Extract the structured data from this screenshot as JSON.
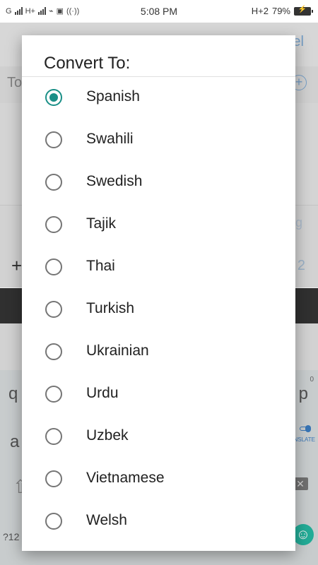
{
  "status_bar": {
    "carrier": "G",
    "network": "H+",
    "time": "5:08 PM",
    "network_right": "H+2",
    "battery": "79%"
  },
  "background": {
    "cancel_label": "el",
    "to_label": "To",
    "plus_label": "+",
    "count_label": "2",
    "g_label": "g"
  },
  "keyboard": {
    "q": "q",
    "p": "p",
    "zero": "0",
    "a": "a",
    "translate": "ANSLATE",
    "sym": "?12"
  },
  "dialog": {
    "title": "Convert To:",
    "selected": "Spanish",
    "accent_color": "#1a8f87",
    "options": [
      {
        "label": "Spanish",
        "checked": true
      },
      {
        "label": "Swahili",
        "checked": false
      },
      {
        "label": "Swedish",
        "checked": false
      },
      {
        "label": "Tajik",
        "checked": false
      },
      {
        "label": "Thai",
        "checked": false
      },
      {
        "label": "Turkish",
        "checked": false
      },
      {
        "label": "Ukrainian",
        "checked": false
      },
      {
        "label": "Urdu",
        "checked": false
      },
      {
        "label": "Uzbek",
        "checked": false
      },
      {
        "label": "Vietnamese",
        "checked": false
      },
      {
        "label": "Welsh",
        "checked": false
      }
    ]
  }
}
